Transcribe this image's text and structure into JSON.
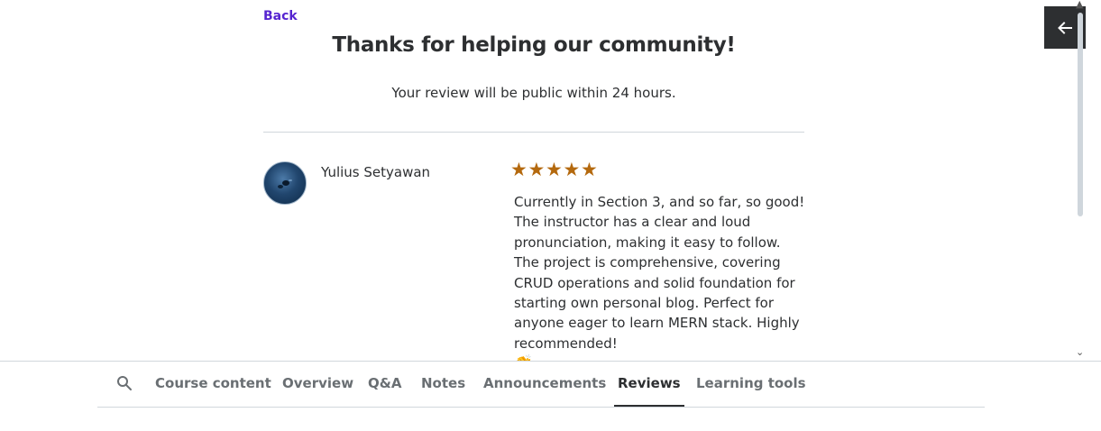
{
  "modal": {
    "back_label": "Back",
    "title": "Thanks for helping our community!",
    "subtitle": "Your review will be public within 24 hours."
  },
  "review": {
    "reviewer_name": "Yulius Setyawan",
    "rating": 5,
    "stars": [
      "★",
      "★",
      "★",
      "★",
      "★"
    ],
    "text": "Currently in Section 3, and so far, so good! The instructor has a clear and loud pronunciation, making it easy to follow. The project is comprehensive, covering CRUD operations and solid foundation for starting own personal blog. Perfect for anyone eager to learn MERN stack. Highly recommended!",
    "emoji": "👏"
  },
  "nav": {
    "search_icon": "search-icon",
    "tabs": [
      {
        "label": "Course content"
      },
      {
        "label": "Overview"
      },
      {
        "label": "Q&A"
      },
      {
        "label": "Notes"
      },
      {
        "label": "Announcements"
      },
      {
        "label": "Reviews",
        "active": true
      },
      {
        "label": "Learning tools"
      }
    ]
  },
  "colors": {
    "accent": "#5624d0",
    "star": "#b4690e",
    "text": "#2d2f31",
    "muted": "#6a6f73"
  },
  "icons": {
    "corner_button": "arrow-left-icon",
    "scroll_up": "scroll-up-icon",
    "scroll_down": "scroll-down-icon"
  }
}
